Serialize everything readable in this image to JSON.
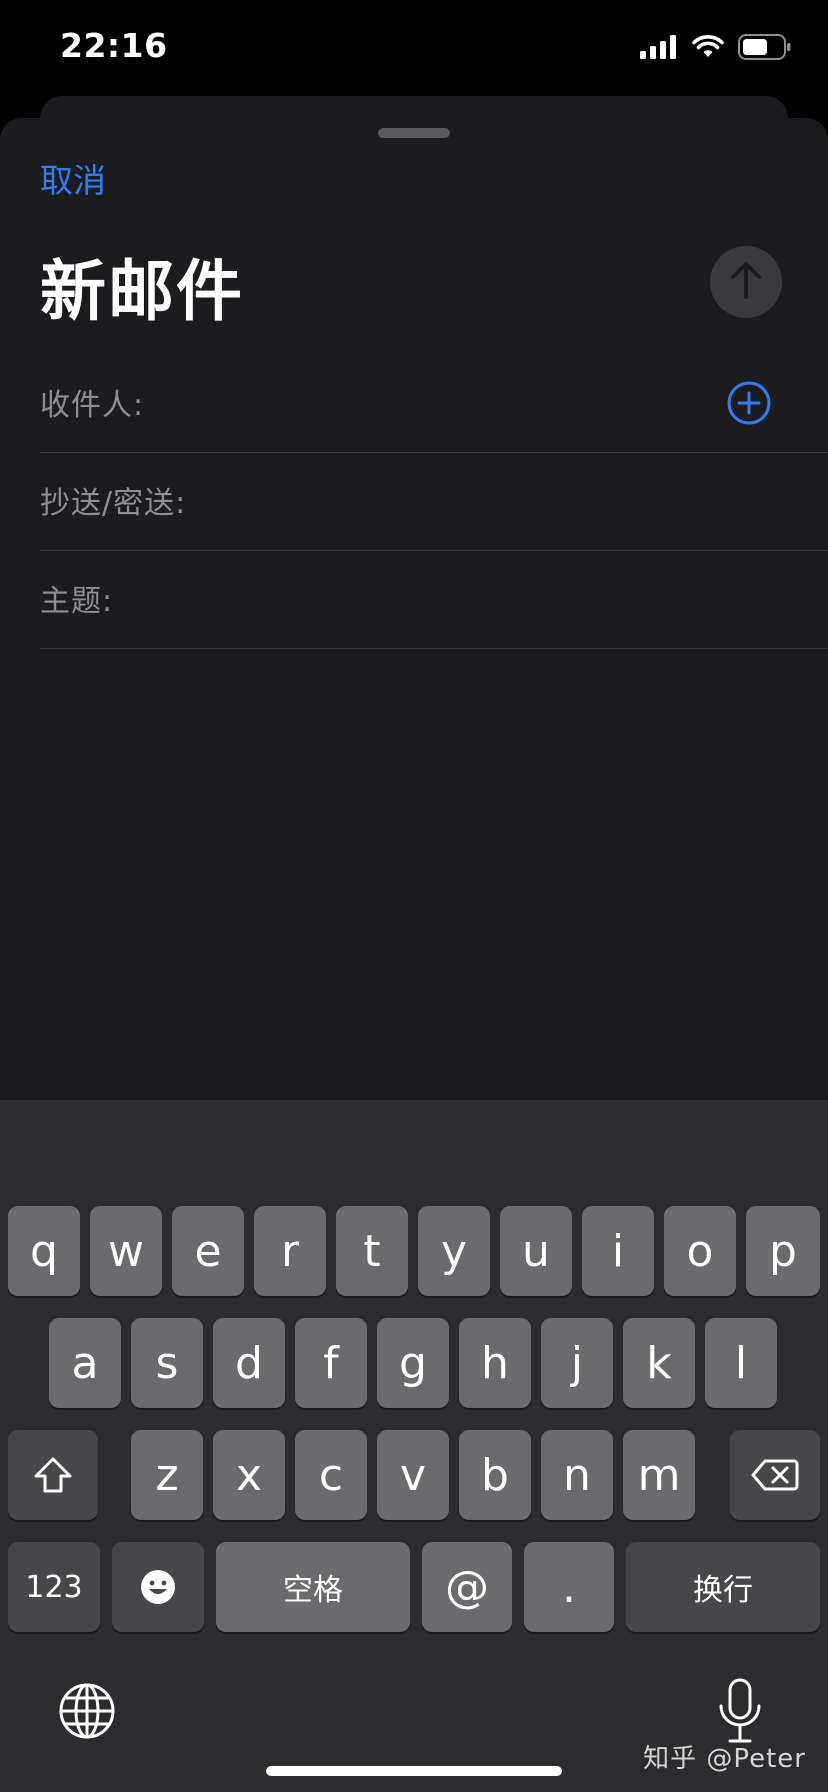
{
  "status_bar": {
    "time": "22:16"
  },
  "compose": {
    "cancel_label": "取消",
    "title": "新邮件",
    "fields": {
      "to_label": "收件人:",
      "cc_bcc_label": "抄送/密送:",
      "subject_label": "主题:"
    }
  },
  "keyboard": {
    "row1": [
      "q",
      "w",
      "e",
      "r",
      "t",
      "y",
      "u",
      "i",
      "o",
      "p"
    ],
    "row2": [
      "a",
      "s",
      "d",
      "f",
      "g",
      "h",
      "j",
      "k",
      "l"
    ],
    "row3": [
      "z",
      "x",
      "c",
      "v",
      "b",
      "n",
      "m"
    ],
    "numbers_label": "123",
    "space_label": "空格",
    "at_label": "@",
    "dot_label": ".",
    "return_label": "换行"
  },
  "watermark": "知乎 @Peter",
  "colors": {
    "accent": "#2f7df6",
    "sheet_background": "#1c1c1e",
    "keyboard_background": "#2c2c2e",
    "key": "#6b6b6e",
    "function_key": "#474749"
  }
}
